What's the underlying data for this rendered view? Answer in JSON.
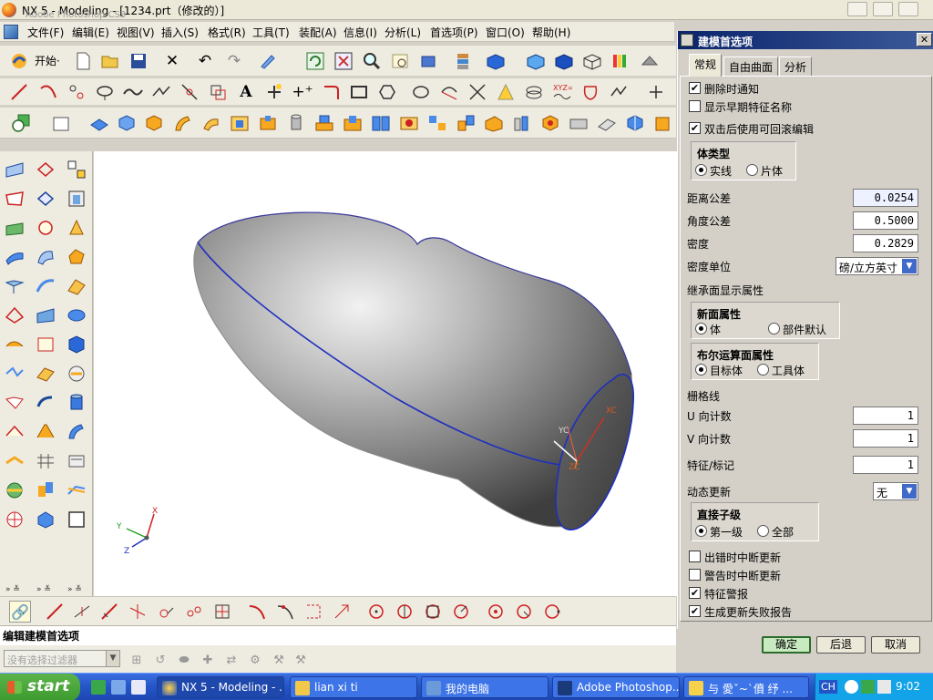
{
  "window": {
    "title": "NX 5 - Modeling - [1234.prt（修改的）]",
    "ghost_title": "Adobe Photoshop CS3"
  },
  "menubar": {
    "items": [
      "文件(F)",
      "编辑(E)",
      "视图(V)",
      "插入(S)",
      "格式(R)",
      "工具(T)",
      "装配(A)",
      "信息(I)",
      "分析(L)",
      "首选项(P)",
      "窗口(O)",
      "帮助(H)"
    ]
  },
  "toolbar": {
    "start_label": "开始·"
  },
  "viewport": {
    "axis_x": "X",
    "axis_y": "Y",
    "axis_z": "Z",
    "wcs_xc": "XC",
    "wcs_yc": "YC",
    "wcs_zc": "ZC"
  },
  "status": {
    "text": "编辑建模首选项",
    "filter_placeholder": "没有选择过滤器"
  },
  "dialog": {
    "title": "建模首选项",
    "tabs": [
      "常规",
      "自由曲面",
      "分析"
    ],
    "checks": {
      "delete_notify": {
        "label": "删除时通知",
        "checked": true
      },
      "show_early_names": {
        "label": "显示早期特征名称",
        "checked": false
      },
      "dblclick_rollback": {
        "label": "双击后使用可回滚编辑",
        "checked": true
      }
    },
    "body_type": {
      "title": "体类型",
      "solid": "实线",
      "sheet": "片体",
      "selected": "solid"
    },
    "fields": {
      "distance_tol_label": "距离公差",
      "distance_tol_value": "0.0254",
      "angle_tol_label": "角度公差",
      "angle_tol_value": "0.5000",
      "density_label": "密度",
      "density_value": "0.2829",
      "density_unit_label": "密度单位",
      "density_unit_value": "磅/立方英寸"
    },
    "inherit": {
      "title": "继承面显示属性",
      "new_face": {
        "title": "新面属性",
        "opt1": "体",
        "opt2": "部件默认"
      },
      "boolean_face": {
        "title": "布尔运算面属性",
        "opt1": "目标体",
        "opt2": "工具体"
      }
    },
    "grid": {
      "title": "栅格线",
      "u_label": "U 向计数",
      "u_value": "1",
      "v_label": "V 向计数",
      "v_value": "1"
    },
    "feature_tag": {
      "label": "特征/标记",
      "value": "1"
    },
    "dynamic_update": {
      "label": "动态更新",
      "value": "无"
    },
    "children": {
      "title": "直接子级",
      "opt1": "第一级",
      "opt2": "全部"
    },
    "bottom_checks": {
      "break_on_error": {
        "label": "出错时中断更新",
        "checked": false
      },
      "break_on_warning": {
        "label": "警告时中断更新",
        "checked": false
      },
      "feature_warning": {
        "label": "特征警报",
        "checked": true
      },
      "fail_report": {
        "label": "生成更新失败报告",
        "checked": true
      }
    },
    "buttons": {
      "ok": "确定",
      "back": "后退",
      "cancel": "取消"
    }
  },
  "taskbar": {
    "start": "start",
    "tasks": [
      "NX 5 - Modeling - ...",
      "lian xi ti",
      "我的电脑",
      "Adobe Photoshop...",
      "与 愛ˇ~ˋ僨 纾 ..."
    ],
    "tray_lang": "CH",
    "clock": "9:02"
  },
  "colors": {
    "title_gradient_start": "#0a246a",
    "accent_blue": "#2455c6",
    "model_edge": "#1f2fbf",
    "ok_green": "#c8eac0"
  }
}
